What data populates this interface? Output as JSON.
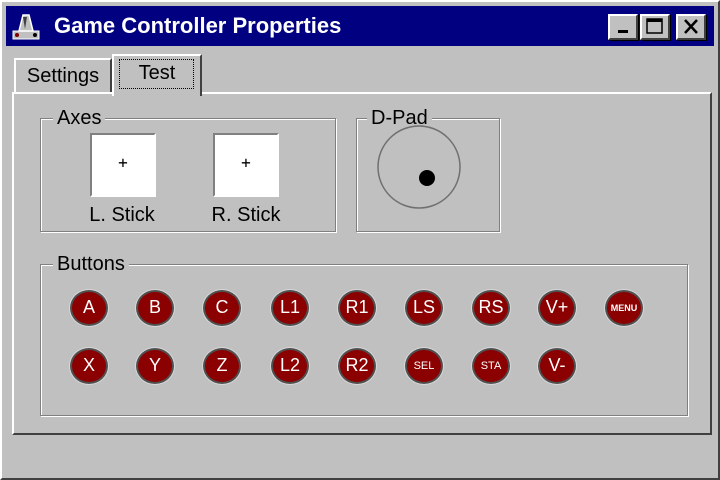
{
  "window": {
    "title": "Game Controller Properties",
    "titlebar_color": "#000080",
    "controls": [
      "minimize-icon",
      "maximize-icon",
      "close-icon"
    ]
  },
  "tabs": [
    {
      "label": "Settings",
      "selected": false
    },
    {
      "label": "Test",
      "selected": true
    }
  ],
  "axes": {
    "label": "Axes",
    "left_stick": {
      "label": "L. Stick",
      "marker": "+"
    },
    "right_stick": {
      "label": "R. Stick",
      "marker": "+"
    }
  },
  "dpad": {
    "label": "D-Pad"
  },
  "buttons": {
    "label": "Buttons",
    "color": "#8b0000",
    "row1": [
      "A",
      "B",
      "C",
      "L1",
      "R1",
      "LS",
      "RS",
      "V+",
      "MENU"
    ],
    "row2": [
      "X",
      "Y",
      "Z",
      "L2",
      "R2",
      "SEL",
      "STA",
      "V-"
    ]
  }
}
